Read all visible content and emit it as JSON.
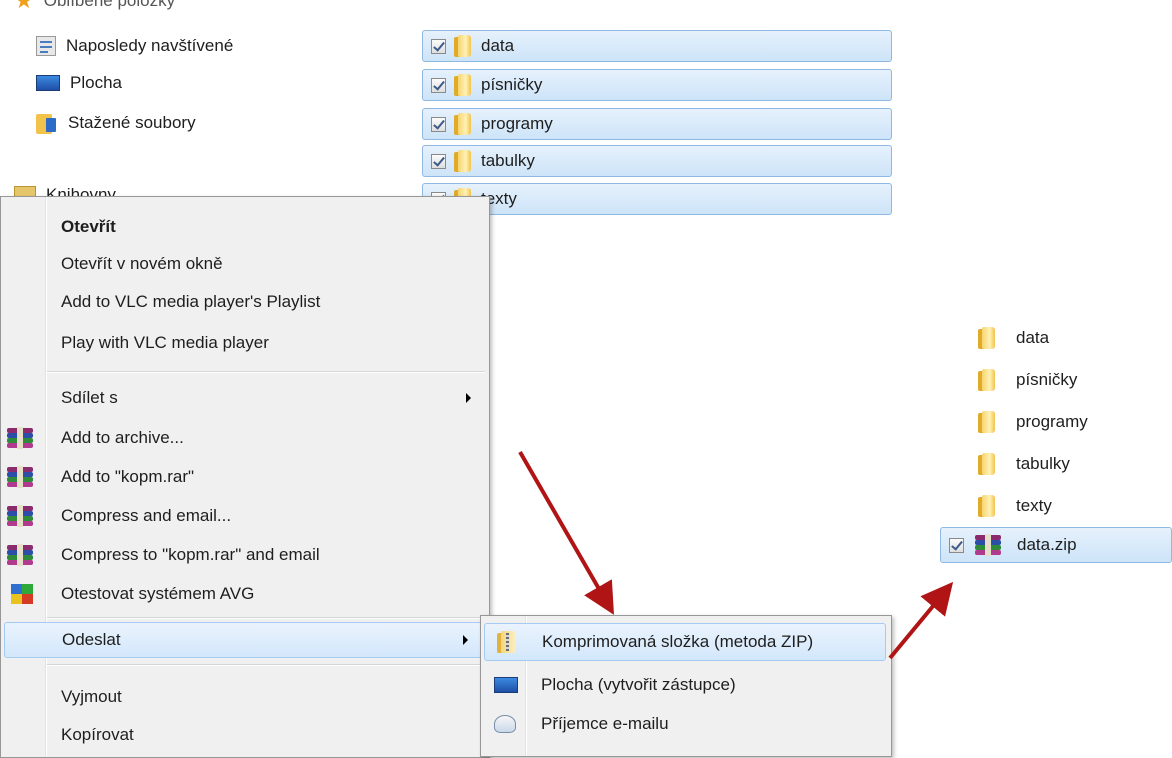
{
  "nav": {
    "items": [
      {
        "label": "Oblíbené položky",
        "icon": "star-icon"
      },
      {
        "label": "Naposledy navštívené",
        "icon": "recent-places-icon"
      },
      {
        "label": "Plocha",
        "icon": "desktop-icon"
      },
      {
        "label": "Stažené soubory",
        "icon": "downloads-folder-icon"
      },
      {
        "label": "Knihovny",
        "icon": "libraries-icon"
      }
    ]
  },
  "files": [
    {
      "name": "data",
      "checked": true
    },
    {
      "name": "písničky",
      "checked": true
    },
    {
      "name": "programy",
      "checked": true
    },
    {
      "name": "tabulky",
      "checked": true
    },
    {
      "name": "texty",
      "checked": true
    }
  ],
  "context_menu": {
    "open": "Otevřít",
    "open_new_window": "Otevřít v novém okně",
    "vlc_playlist": "Add to VLC media player's Playlist",
    "vlc_play": "Play with VLC media player",
    "share_with": "Sdílet s",
    "add_archive": "Add to archive...",
    "add_rar": "Add to \"kopm.rar\"",
    "compress_email": "Compress and email...",
    "compress_rar_email": "Compress to \"kopm.rar\" and email",
    "avg_scan": "Otestovat systémem AVG",
    "send_to": "Odeslat",
    "cut": "Vyjmout",
    "copy": "Kopírovat"
  },
  "submenu": {
    "zip": "Komprimovaná složka (metoda ZIP)",
    "desktop": "Plocha (vytvořit zástupce)",
    "mail": "Příjemce e-mailu"
  },
  "result": {
    "items": [
      "data",
      "písničky",
      "programy",
      "tabulky",
      "texty"
    ],
    "zip": "data.zip"
  },
  "colors": {
    "arrow": "#b01414",
    "selection": "#cde4f8",
    "menu_bg": "#f0f0f0"
  }
}
